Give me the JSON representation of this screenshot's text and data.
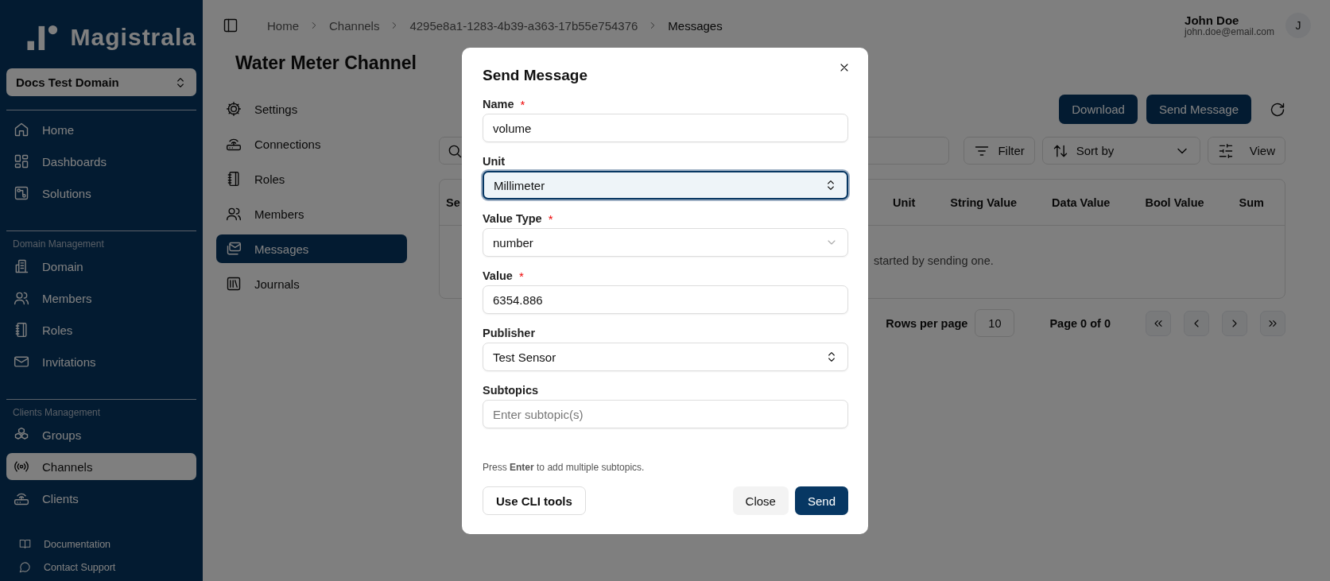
{
  "sidebar": {
    "logo": "Magistrala",
    "domain_selector": "Docs Test Domain",
    "sections": [
      {
        "items": [
          {
            "label": "Home",
            "selected": false
          },
          {
            "label": "Dashboards",
            "selected": false
          },
          {
            "label": "Solutions",
            "selected": false
          }
        ]
      },
      {
        "heading": "Domain Management",
        "items": [
          {
            "label": "Domain",
            "selected": false
          },
          {
            "label": "Members",
            "selected": false
          },
          {
            "label": "Roles",
            "selected": false
          },
          {
            "label": "Invitations",
            "selected": false
          }
        ]
      },
      {
        "heading": "Clients Management",
        "items": [
          {
            "label": "Groups",
            "selected": false
          },
          {
            "label": "Channels",
            "selected": true
          },
          {
            "label": "Clients",
            "selected": false
          }
        ]
      }
    ],
    "footer_links": [
      "Documentation",
      "Contact Support"
    ]
  },
  "header": {
    "breadcrumb": [
      "Home",
      "Channels",
      "4295e8a1-1283-4b39-a363-17b55e754376",
      "Messages"
    ],
    "user": {
      "name": "John Doe",
      "email": "john.doe@email.com",
      "avatar_initial": "J"
    }
  },
  "page_title": "Water Meter Channel",
  "channel_nav": [
    {
      "label": "Settings",
      "selected": false
    },
    {
      "label": "Connections",
      "selected": false
    },
    {
      "label": "Roles",
      "selected": false
    },
    {
      "label": "Members",
      "selected": false
    },
    {
      "label": "Messages",
      "selected": true
    },
    {
      "label": "Journals",
      "selected": false
    }
  ],
  "actions": [
    "Download",
    "Send Message"
  ],
  "toolbar": {
    "filter": "Filter",
    "sort": "Sort by",
    "view": "View"
  },
  "table": {
    "columns": [
      "Se",
      "Unit",
      "String Value",
      "Data Value",
      "Bool Value",
      "Sum"
    ],
    "empty_message": "started by sending one."
  },
  "pagination": {
    "rows_per_page_label": "Rows per page",
    "rows_per_page": "10",
    "page_info": "Page 0 of 0"
  },
  "dialog": {
    "title": "Send Message",
    "fields": [
      {
        "label": "Name",
        "required_mark": "*",
        "kind": "input",
        "value": "volume",
        "focused": false
      },
      {
        "label": "Unit",
        "kind": "combobox",
        "value": "Millimeter",
        "focused": true
      },
      {
        "label": "Value Type",
        "required_mark": "*",
        "kind": "select",
        "value": "number",
        "focused": false
      },
      {
        "label": "Value",
        "required_mark": "*",
        "kind": "input",
        "value": "6354.886",
        "focused": false
      },
      {
        "label": "Publisher",
        "kind": "combobox",
        "value": "Test Sensor",
        "focused": false
      },
      {
        "label": "Subtopics",
        "kind": "input",
        "placeholder": "Enter subtopic(s)",
        "focused": false
      }
    ],
    "hint": "Press **Enter** to add multiple subtopics.",
    "secondary_button": "Use CLI tools",
    "cancel_button": "Close",
    "submit_button": "Send"
  }
}
